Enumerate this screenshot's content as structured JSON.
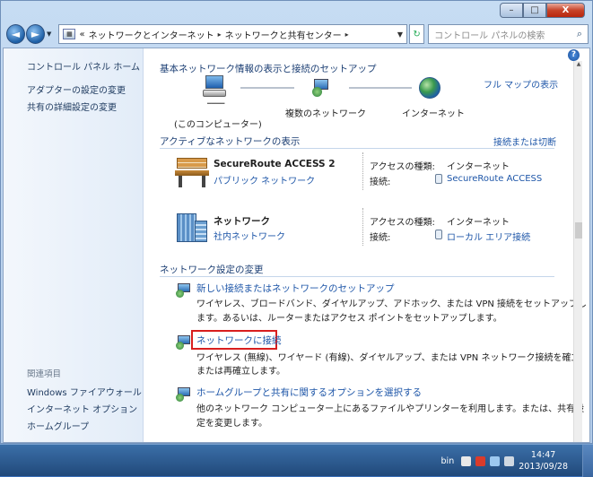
{
  "window": {
    "caption_buttons": {
      "minimize": "–",
      "maximize": "□",
      "close": "X"
    }
  },
  "nav": {
    "back_label": "◄",
    "forward_label": "►",
    "dropdown": "▼",
    "breadcrumb_overflow": "«",
    "breadcrumb": [
      "ネットワークとインターネット",
      "ネットワークと共有センター"
    ],
    "search_placeholder": "コントロール パネルの検索"
  },
  "sidebar": {
    "home": "コントロール パネル ホーム",
    "links": [
      "アダプターの設定の変更",
      "共有の詳細設定の変更"
    ],
    "see_also_title": "関連項目",
    "see_also": [
      "Windows ファイアウォール",
      "インターネット オプション",
      "ホームグループ"
    ]
  },
  "main": {
    "header": "基本ネットワーク情報の表示と接続のセットアップ",
    "full_map_link": "フル マップの表示",
    "map": {
      "computer_name": "━━━━",
      "computer_label": "(このコンピューター)",
      "middle_label": "複数のネットワーク",
      "right_label": "インターネット"
    },
    "active_title": "アクティブなネットワークの表示",
    "connect_disconnect": "接続または切断",
    "networks": [
      {
        "name": "SecureRoute ACCESS  2",
        "category": "パブリック ネットワーク",
        "access_label": "アクセスの種類:",
        "access_value": "インターネット",
        "conn_label": "接続:",
        "conn_value": "SecureRoute ACCESS"
      },
      {
        "name": "ネットワーク",
        "category": "社内ネットワーク",
        "access_label": "アクセスの種類:",
        "access_value": "インターネット",
        "conn_label": "接続:",
        "conn_value": "ローカル エリア接続"
      }
    ],
    "change_title": "ネットワーク設定の変更",
    "tasks": [
      {
        "link": "新しい接続またはネットワークのセットアップ",
        "desc1": "ワイヤレス、ブロードバンド、ダイヤルアップ、アドホック、または VPN 接続をセットアップし",
        "desc2": "ます。あるいは、ルーターまたはアクセス ポイントをセットアップします。"
      },
      {
        "link": "ネットワークに接続",
        "desc1": "ワイヤレス (無線)、ワイヤード (有線)、ダイヤルアップ、または VPN ネットワーク接続を確立",
        "desc2": "または再確立します。"
      },
      {
        "link": "ホームグループと共有に関するオプションを選択する",
        "desc1": "他のネットワーク コンピューター上にあるファイルやプリンターを利用します。または、共有設",
        "desc2": "定を変更します。"
      }
    ],
    "help_label": "?"
  },
  "taskbar": {
    "lang": "bin",
    "time": "14:47",
    "date": "2013/09/28"
  },
  "colors": {
    "link": "#1e56a8",
    "highlight": "#d81e1e",
    "taskbar": "#21497a"
  }
}
